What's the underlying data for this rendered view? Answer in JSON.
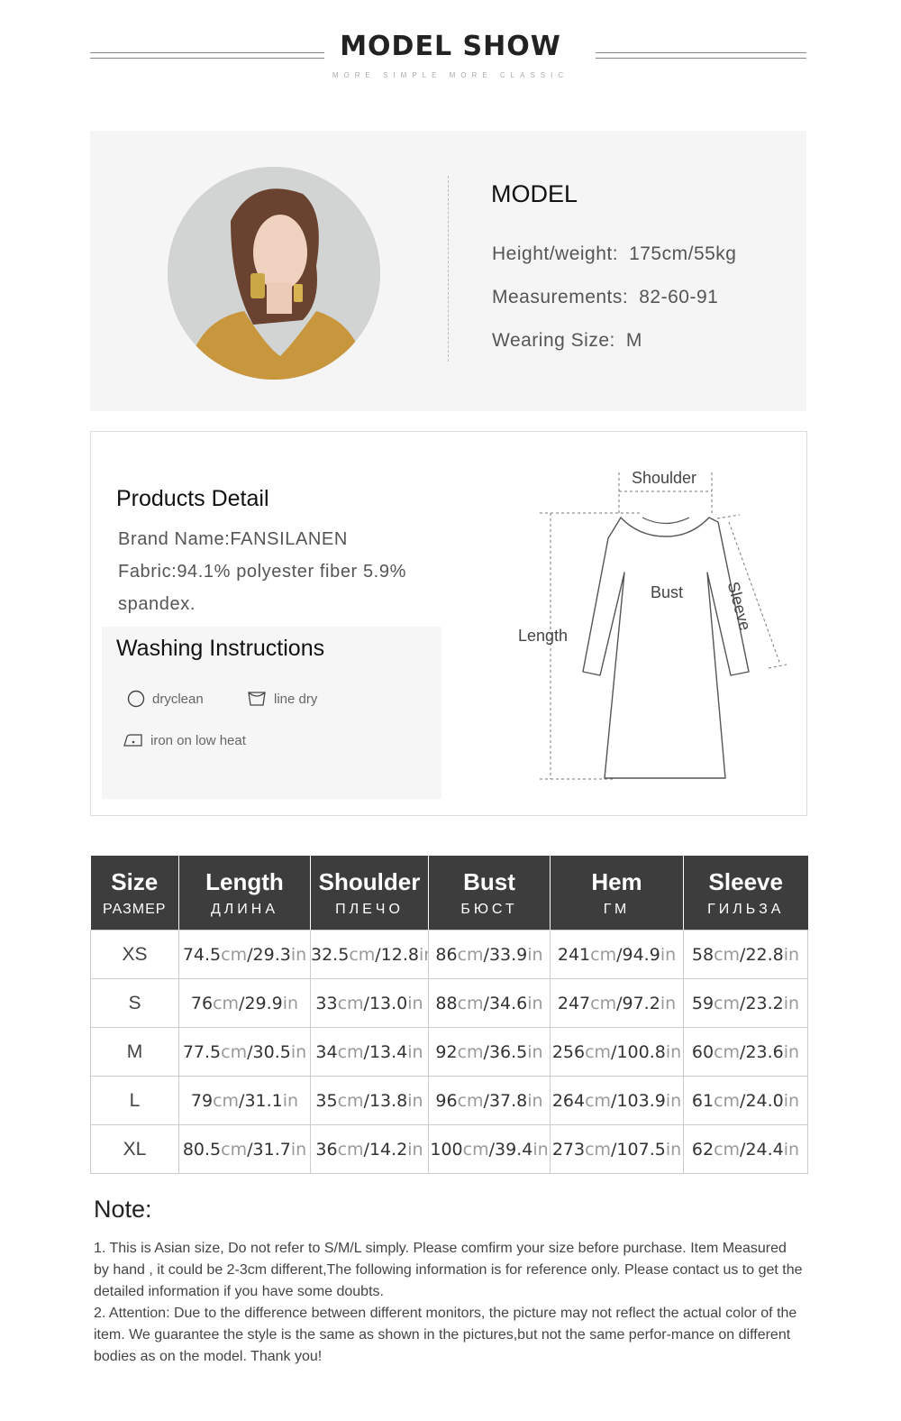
{
  "header": {
    "title": "MODEL SHOW",
    "subtitle": "MORE SIMPLE MORE CLASSIC"
  },
  "model": {
    "heading": "MODEL",
    "rows": [
      {
        "label": "Height/weight:",
        "value": "175cm/55kg"
      },
      {
        "label": "Measurements:",
        "value": "82-60-91"
      },
      {
        "label": "Wearing Size:",
        "value": "M"
      }
    ]
  },
  "products": {
    "title": "Products Detail",
    "brand": "Brand Name:FANSILANEN",
    "fabric_line1": "Fabric:94.1% polyester fiber 5.9%",
    "fabric_line2": "spandex."
  },
  "washing": {
    "title": "Washing Instructions",
    "items": [
      {
        "icon": "dryclean-circle-icon",
        "label": "dryclean"
      },
      {
        "icon": "line-dry-icon",
        "label": "line dry"
      },
      {
        "icon": "iron-icon",
        "label": "iron on low heat"
      }
    ]
  },
  "diagram": {
    "shoulder": "Shoulder",
    "bust": "Bust",
    "length": "Length",
    "sleeve": "Sleeve"
  },
  "size_table": {
    "unit_cm": "cm",
    "unit_in": "in",
    "columns": [
      {
        "en": "Size",
        "ru": "РАЗМЕР"
      },
      {
        "en": "Length",
        "ru": "ДЛИНА"
      },
      {
        "en": "Shoulder",
        "ru": "ПЛЕЧО"
      },
      {
        "en": "Bust",
        "ru": "БЮСТ"
      },
      {
        "en": "Hem",
        "ru": "ГМ"
      },
      {
        "en": "Sleeve",
        "ru": "ГИЛЬЗА"
      }
    ],
    "rows": [
      {
        "size": "XS",
        "cells": [
          [
            "74.5",
            "/29.3"
          ],
          [
            "32.5",
            "/12.8"
          ],
          [
            "86",
            "/33.9"
          ],
          [
            "241",
            "/94.9"
          ],
          [
            "58",
            "/22.8"
          ]
        ]
      },
      {
        "size": "S",
        "cells": [
          [
            "76",
            "/29.9"
          ],
          [
            "33",
            "/13.0"
          ],
          [
            "88",
            "/34.6"
          ],
          [
            "247",
            "/97.2"
          ],
          [
            "59",
            "/23.2"
          ]
        ]
      },
      {
        "size": "M",
        "cells": [
          [
            "77.5",
            "/30.5"
          ],
          [
            "34",
            "/13.4"
          ],
          [
            "92",
            "/36.5"
          ],
          [
            "256",
            "/100.8"
          ],
          [
            "60",
            "/23.6"
          ]
        ]
      },
      {
        "size": "L",
        "cells": [
          [
            "79",
            "/31.1"
          ],
          [
            "35",
            "/13.8"
          ],
          [
            "96",
            "/37.8"
          ],
          [
            "264",
            "/103.9"
          ],
          [
            "61",
            "/24.0"
          ]
        ]
      },
      {
        "size": "XL",
        "cells": [
          [
            "80.5",
            "/31.7"
          ],
          [
            "36",
            "/14.2"
          ],
          [
            "100",
            "/39.4"
          ],
          [
            "273",
            "/107.5"
          ],
          [
            "62",
            "/24.4"
          ]
        ]
      }
    ]
  },
  "note": {
    "heading": "Note:",
    "p1": "1. This is Asian size, Do not refer to S/M/L simply. Please comfirm your size before purchase. Item Measured by hand , it could be 2-3cm different,The following information is for reference only. Please contact us to get the detailed information if you have some doubts.",
    "p2": "2. Attention: Due to the difference between different monitors, the picture may not reflect the actual color of the item. We guarantee the style is the same as shown in the pictures,but not the same perfor-mance on different bodies as on the model. Thank you!"
  },
  "colors": {
    "header_bg": "#3d3d3d",
    "panel_bg": "#f5f5f5",
    "model_top": "#c8963c"
  }
}
